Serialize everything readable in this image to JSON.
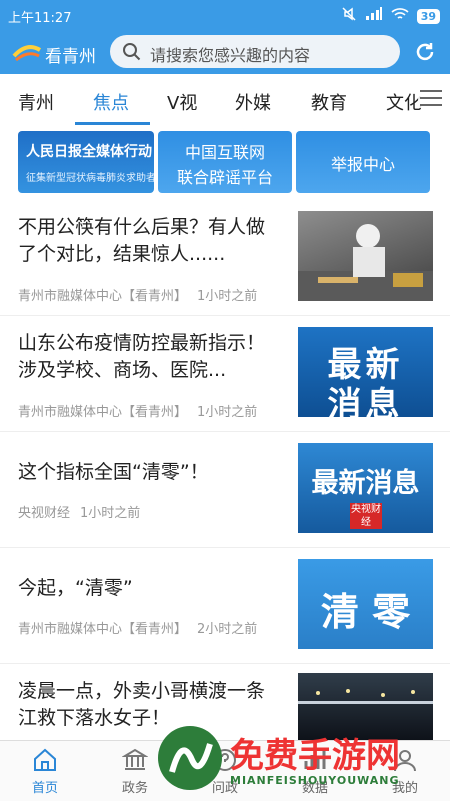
{
  "status_bar": {
    "time": "上午11:27",
    "battery": "39"
  },
  "header": {
    "app_name": "看青州",
    "search_placeholder": "请搜索您感兴趣的内容"
  },
  "tabs": [
    {
      "label": "青州"
    },
    {
      "label": "焦点",
      "active": true
    },
    {
      "label": "V视"
    },
    {
      "label": "外媒"
    },
    {
      "label": "教育"
    },
    {
      "label": "文化"
    }
  ],
  "banners": [
    {
      "line1": "人民日报全媒体行动",
      "line2": "征集新型冠状病毒肺炎求助者信息"
    },
    {
      "line1": "中国互联网",
      "line2": "联合辟谣平台"
    },
    {
      "line1": "举报中心"
    }
  ],
  "news": [
    {
      "title": "不用公筷有什么后果？有人做了个对比，结果惊人......",
      "source": "青州市融媒体中心【看青州】",
      "time": "1小时之前"
    },
    {
      "title": "山东公布疫情防控最新指示！涉及学校、商场、医院...",
      "source": "青州市融媒体中心【看青州】",
      "time": "1小时之前",
      "thumb_text": "最新消息"
    },
    {
      "title": "这个指标全国“清零”！",
      "source": "央视财经",
      "time": "1小时之前",
      "thumb_text": "最新消息",
      "thumb_badge": "央视财经"
    },
    {
      "title": "今起，“清零”",
      "source": "青州市融媒体中心【看青州】",
      "time": "2小时之前",
      "thumb_text": "清 零"
    },
    {
      "title": "凌晨一点，外卖小哥横渡一条江救下落水女子！",
      "source": "",
      "time": ""
    }
  ],
  "bottom_nav": [
    {
      "label": "首页",
      "active": true
    },
    {
      "label": "政务"
    },
    {
      "label": "问政"
    },
    {
      "label": "数据"
    },
    {
      "label": "我的"
    }
  ],
  "watermark": {
    "text": "免费手游网",
    "subtext": "MIANFEISHOUYOUWANG"
  },
  "colors": {
    "primary": "#3a9be6",
    "accent": "#2a86d6"
  }
}
